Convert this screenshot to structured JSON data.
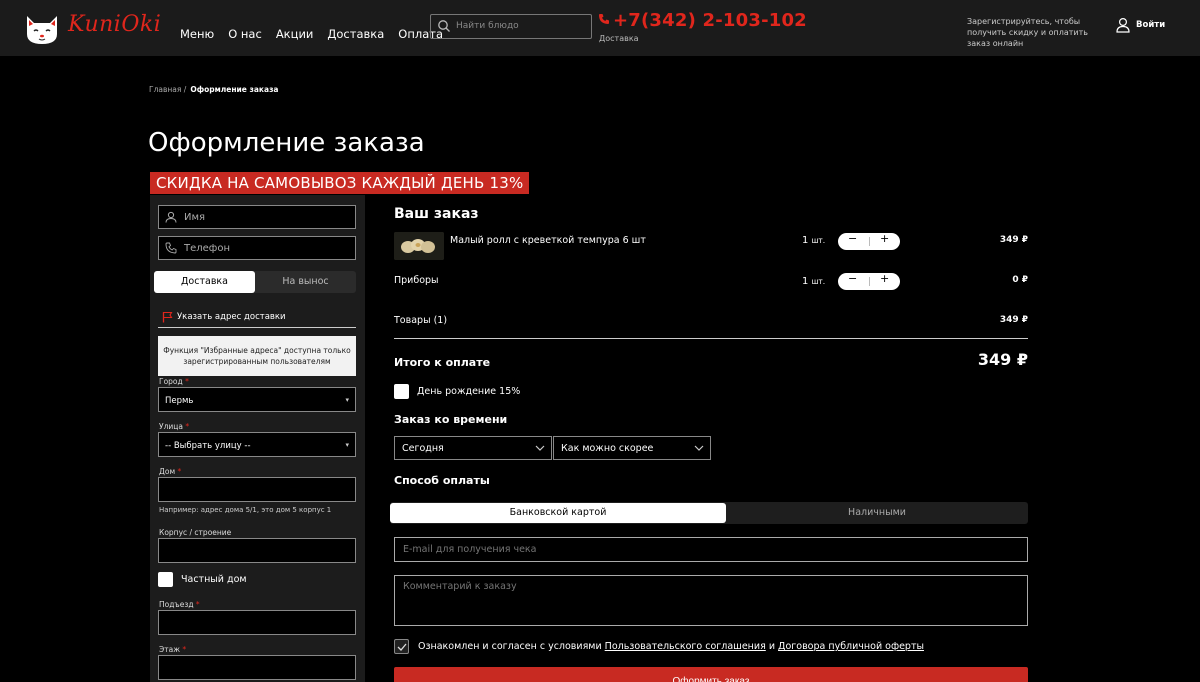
{
  "header": {
    "logo_text": "KuniOki",
    "nav": [
      "Меню",
      "О нас",
      "Акции",
      "Доставка",
      "Оплата"
    ],
    "search_placeholder": "Найти блюдо",
    "phone": "+7(342) 2-103-102",
    "phone_sub": "Доставка",
    "register_note": "Зарегистрируйтесь, чтобы получить скидку и оплатить заказ онлайн",
    "login_label": "Войти",
    "accent_color": "#e0261c"
  },
  "breadcrumb": {
    "home": "Главная /",
    "current": "Оформление заказа"
  },
  "page_title": "Оформление заказа",
  "promo_banner": "СКИДКА НА САМОВЫВОЗ КАЖДЫЙ ДЕНЬ 13%",
  "contact_form": {
    "name_placeholder": "Имя",
    "phone_placeholder": "Телефон",
    "delivery_tab": "Доставка",
    "pickup_tab": "На вынос",
    "address_link": "Указать адрес доставки",
    "favorites_note": "Функция \"Избранные адреса\" доступна только зарегистрированным пользователям",
    "city_label": "Город",
    "city_value": "Пермь",
    "street_label": "Улица",
    "street_value": "-- Выбрать улицу --",
    "house_label": "Дом",
    "house_hint": "Например: адрес дома 5/1, это дом 5 корпус 1",
    "building_label": "Корпус / строение",
    "private_house_label": "Частный дом",
    "entrance_label": "Подъезд",
    "floor_label": "Этаж",
    "required_mark": "*"
  },
  "order": {
    "title": "Ваш заказ",
    "items": [
      {
        "name": "Малый ролл с креветкой темпура 6 шт",
        "qty": "1",
        "unit": "шт.",
        "price": "349 ₽"
      }
    ],
    "cutlery": {
      "name": "Приборы",
      "qty": "1",
      "unit": "шт.",
      "price": "0 ₽"
    },
    "subtotal_label": "Товары (1)",
    "subtotal_price": "349 ₽",
    "total_label": "Итого к оплате",
    "total_price": "349 ₽",
    "birthday_label": "День рождение 15%",
    "time_title": "Заказ ко времени",
    "day_value": "Сегодня",
    "time_value": "Как можно скорее",
    "payment_title": "Способ оплаты",
    "pay_card": "Банковской картой",
    "pay_cash": "Наличными",
    "email_placeholder": "E-mail для получения чека",
    "comment_placeholder": "Комментарий к заказу",
    "agree_text": "Ознакомлен и согласен с условиями",
    "agree_link1": "Пользовательского соглашения",
    "agree_and": "и",
    "agree_link2": "Договора публичной оферты",
    "submit_label": "Оформить заказ"
  }
}
